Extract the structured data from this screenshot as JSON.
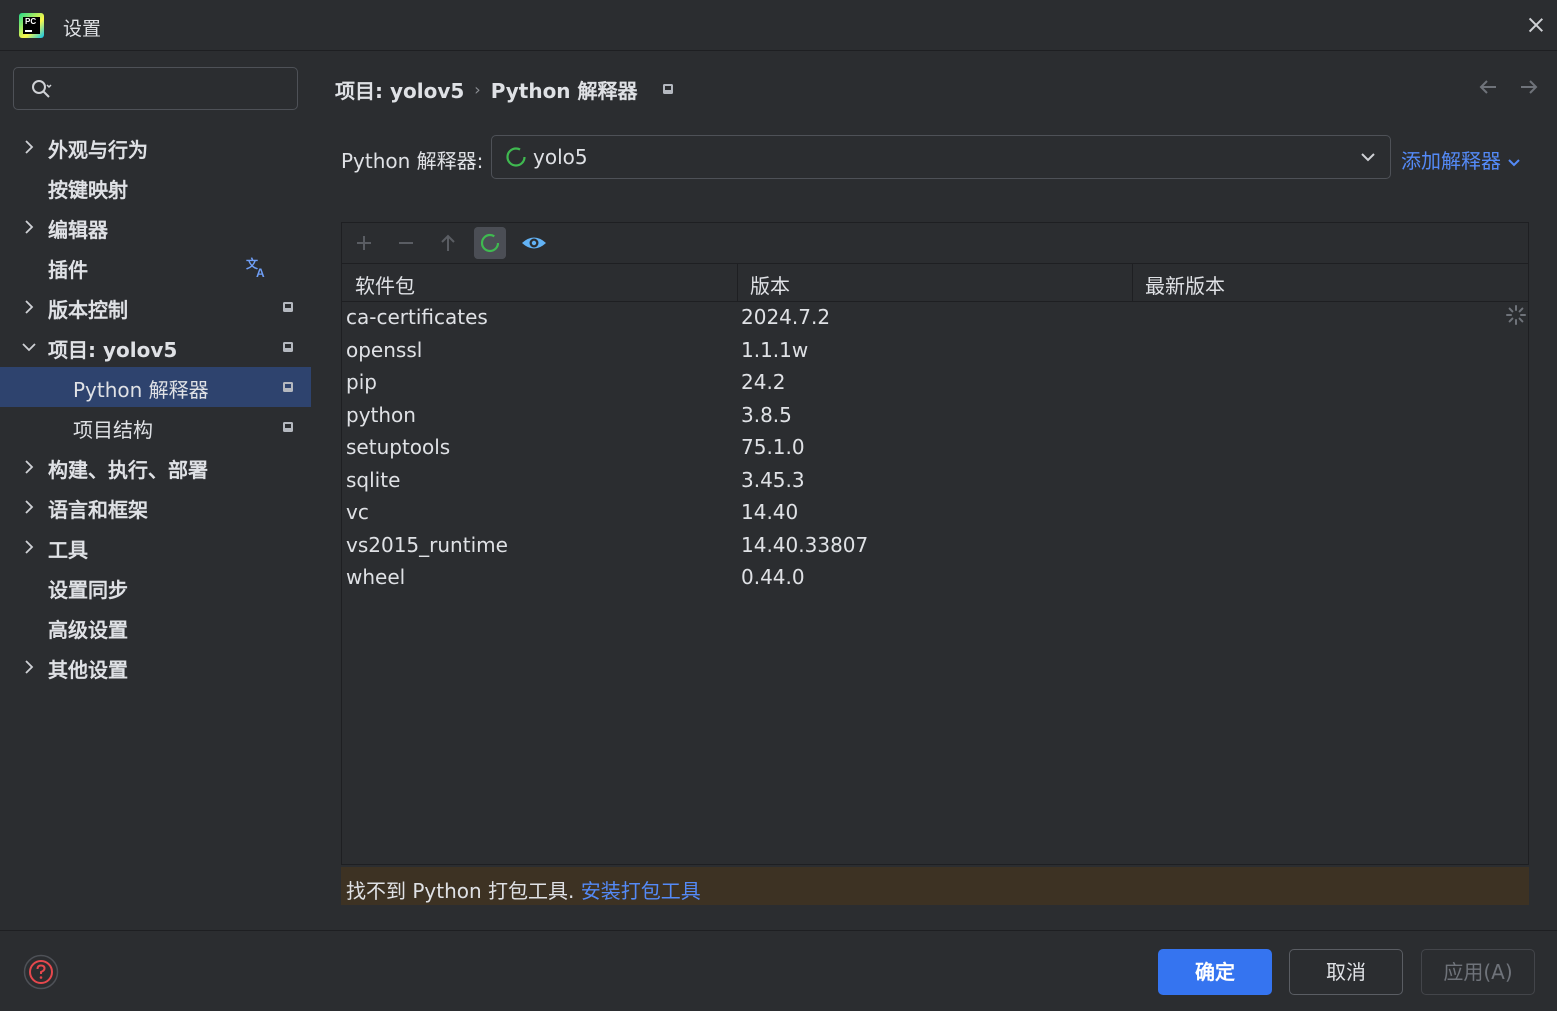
{
  "window": {
    "title": "设置"
  },
  "search": {
    "placeholder": ""
  },
  "sidebar": {
    "items": [
      {
        "label": "外观与行为"
      },
      {
        "label": "按键映射"
      },
      {
        "label": "编辑器"
      },
      {
        "label": "插件"
      },
      {
        "label": "版本控制"
      },
      {
        "label": "项目: yolov5"
      },
      {
        "label": "Python 解释器"
      },
      {
        "label": "项目结构"
      },
      {
        "label": "构建、执行、部署"
      },
      {
        "label": "语言和框架"
      },
      {
        "label": "工具"
      },
      {
        "label": "设置同步"
      },
      {
        "label": "高级设置"
      },
      {
        "label": "其他设置"
      }
    ]
  },
  "breadcrumb": {
    "project": "项目: yolov5",
    "separator": "›",
    "page": "Python 解释器"
  },
  "interpreter": {
    "label": "Python 解释器:",
    "value": "yolo5",
    "add_label": "添加解释器"
  },
  "packages": {
    "columns": {
      "name": "软件包",
      "version": "版本",
      "latest": "最新版本"
    },
    "rows": [
      {
        "name": "ca-certificates",
        "version": "2024.7.2"
      },
      {
        "name": "openssl",
        "version": "1.1.1w"
      },
      {
        "name": "pip",
        "version": "24.2"
      },
      {
        "name": "python",
        "version": "3.8.5"
      },
      {
        "name": "setuptools",
        "version": "75.1.0"
      },
      {
        "name": "sqlite",
        "version": "3.45.3"
      },
      {
        "name": "vc",
        "version": "14.40"
      },
      {
        "name": "vs2015_runtime",
        "version": "14.40.33807"
      },
      {
        "name": "wheel",
        "version": "0.44.0"
      }
    ]
  },
  "warning": {
    "message": "找不到 Python 打包工具. ",
    "link": "安装打包工具"
  },
  "footer": {
    "ok": "确定",
    "cancel": "取消",
    "apply": "应用(A)"
  },
  "colors": {
    "accent": "#3574f0",
    "link": "#548af7",
    "selected": "#2e436e",
    "warning_bg": "#3d3223"
  }
}
